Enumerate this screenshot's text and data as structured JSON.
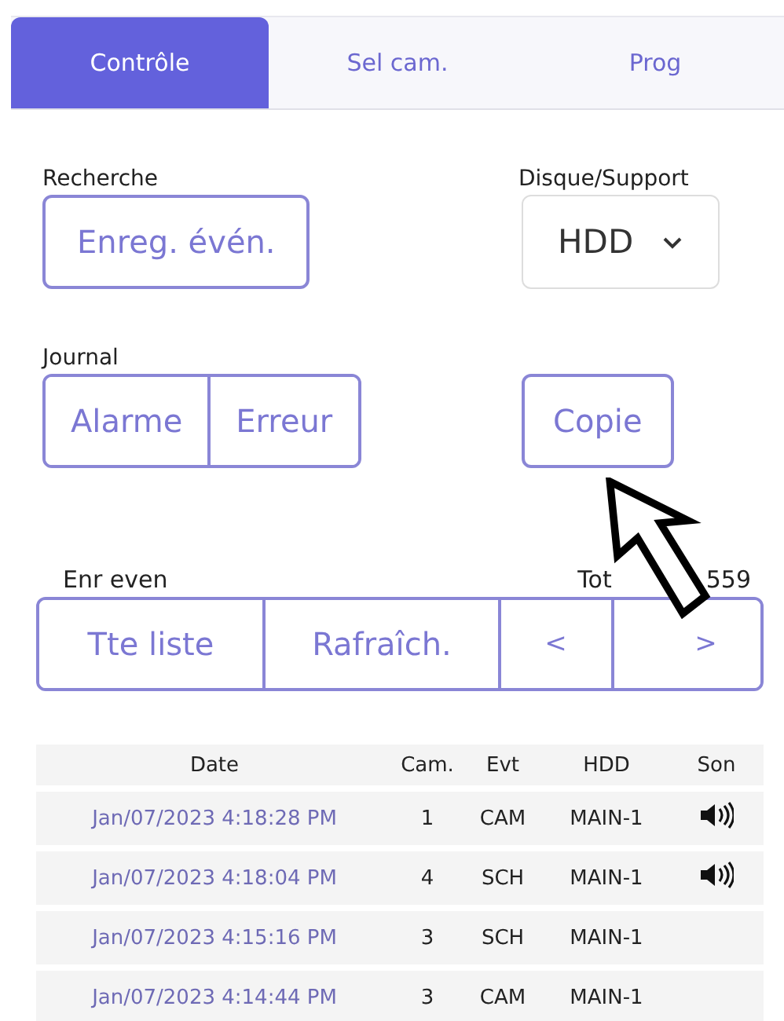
{
  "tabs": [
    {
      "label": "Contrôle",
      "selected": true
    },
    {
      "label": "Sel cam.",
      "selected": false
    },
    {
      "label": "Prog",
      "selected": false
    }
  ],
  "search": {
    "label": "Recherche",
    "button": "Enreg. évén."
  },
  "disk": {
    "label": "Disque/Support",
    "value": "HDD"
  },
  "journal": {
    "label": "Journal",
    "buttons": [
      "Alarme",
      "Erreur"
    ]
  },
  "copy_button": "Copie",
  "events": {
    "label": "Enr even",
    "total_parts": [
      "Tot",
      "559"
    ],
    "buttons": [
      "Tte liste",
      "Rafraîch.",
      "<",
      ">"
    ]
  },
  "table": {
    "columns": [
      "Date",
      "Cam.",
      "Evt",
      "HDD",
      "Son"
    ],
    "rows": [
      {
        "date": "Jan/07/2023 4:18:28 PM",
        "cam": "1",
        "evt": "CAM",
        "hdd": "MAIN-1",
        "sound": true
      },
      {
        "date": "Jan/07/2023 4:18:04 PM",
        "cam": "4",
        "evt": "SCH",
        "hdd": "MAIN-1",
        "sound": true
      },
      {
        "date": "Jan/07/2023 4:15:16 PM",
        "cam": "3",
        "evt": "SCH",
        "hdd": "MAIN-1",
        "sound": false
      },
      {
        "date": "Jan/07/2023 4:14:44 PM",
        "cam": "3",
        "evt": "CAM",
        "hdd": "MAIN-1",
        "sound": false
      }
    ]
  }
}
